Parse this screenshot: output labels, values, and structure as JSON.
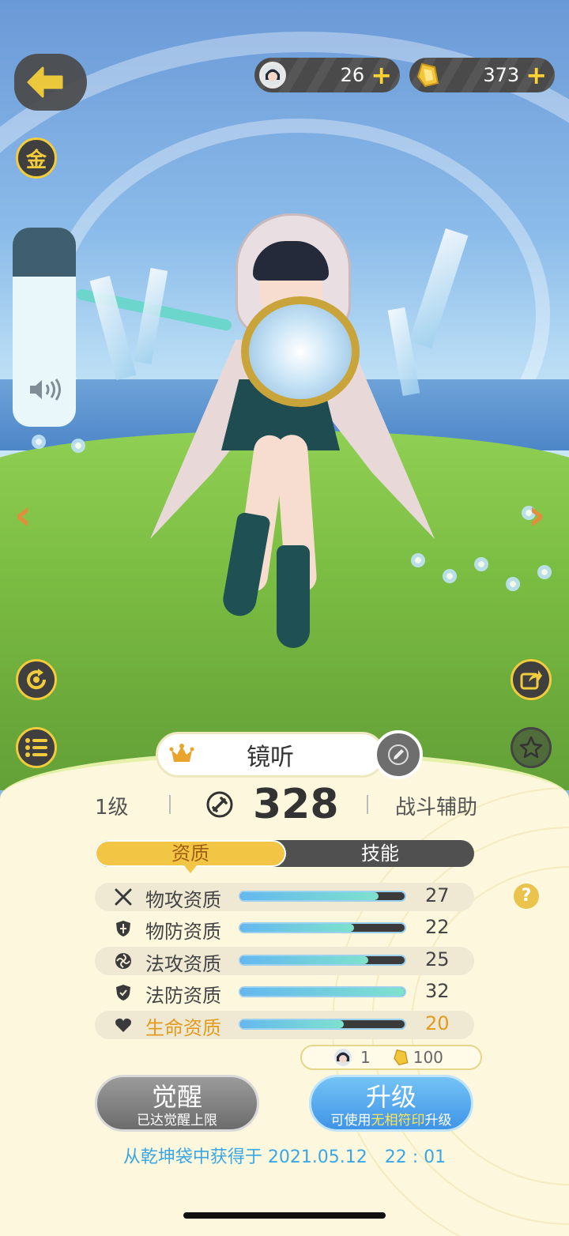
{
  "hud": {
    "currencies": [
      {
        "icon": "avatar-token-icon",
        "value": "26",
        "plus": "+"
      },
      {
        "icon": "gold-ingot-icon",
        "value": "373",
        "plus": "+"
      }
    ],
    "gold_label": "金"
  },
  "character": {
    "name": "镜听",
    "level": "1级",
    "power": "328",
    "role": "战斗辅助"
  },
  "tabs": [
    {
      "label": "资质",
      "active": true
    },
    {
      "label": "技能",
      "active": false
    }
  ],
  "attributes": [
    {
      "icon": "swords-icon",
      "label": "物攻资质",
      "value": "27",
      "fill": 0.84
    },
    {
      "icon": "shield-icon",
      "label": "物防资质",
      "value": "22",
      "fill": 0.69
    },
    {
      "icon": "swirl-icon",
      "label": "法攻资质",
      "value": "25",
      "fill": 0.78
    },
    {
      "icon": "shield-icon",
      "label": "法防资质",
      "value": "32",
      "fill": 1.0
    },
    {
      "icon": "heart-icon",
      "label": "生命资质",
      "value": "20",
      "fill": 0.63
    }
  ],
  "help_label": "?",
  "cost": {
    "token": "1",
    "gold": "100"
  },
  "buttons": {
    "awaken": {
      "title": "觉醒",
      "sub": "已达觉醒上限"
    },
    "upgrade": {
      "title": "升级",
      "sub_pre": "可使用",
      "sub_hl": "无相符印",
      "sub_post": "升级"
    }
  },
  "obtained": "从乾坤袋中获得于 2021.05.12　22 : 01",
  "colors": {
    "accent_gold": "#f2c545",
    "hp_orange": "#e39a1f",
    "upgrade_blue": "#3f94e6",
    "obtain_blue": "#3aa6e6"
  }
}
